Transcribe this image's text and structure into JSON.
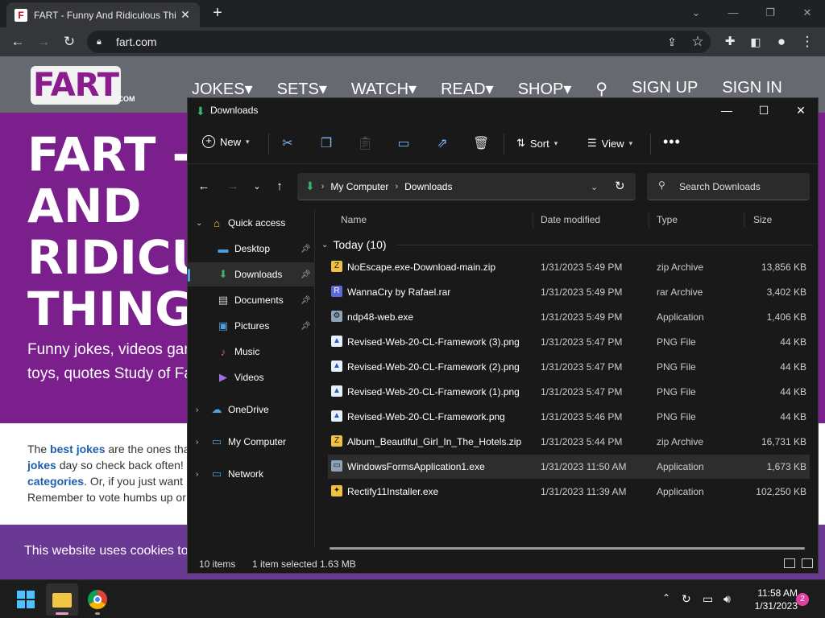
{
  "chrome": {
    "tab_title": "FART - Funny And Ridiculous Thi",
    "tab_favicon": "F",
    "url": "fart.com"
  },
  "site": {
    "logo": "FART",
    "logo_suffix": ".COM",
    "nav": [
      "JOKES",
      "SETS",
      "WATCH",
      "READ",
      "SHOP",
      "SIGN UP",
      "SIGN IN"
    ],
    "hero_title": "FART - AND RIDICU THINGS",
    "hero_sub": "Funny jokes, videos games, toys, quotes Study of Farts).",
    "body_text_1": "The ",
    "body_link_1": "best jokes",
    "body_text_2": " are the ones tha",
    "body_link_2": "jokes",
    "body_text_3": " day so check back often!",
    "body_link_3": "categories",
    "body_text_4": ".  Or, if you just want",
    "body_text_5": "Remember to vote humbs up or",
    "cookie_text": "This website uses cookies to"
  },
  "explorer": {
    "title": "Downloads",
    "cmd": {
      "new": "New",
      "sort": "Sort",
      "view": "View"
    },
    "breadcrumb": [
      "My Computer",
      "Downloads"
    ],
    "search_placeholder": "Search Downloads",
    "nav_pane": [
      {
        "label": "Quick access",
        "icon": "star-home-icon"
      },
      {
        "label": "Desktop",
        "icon": "desktop-icon",
        "pinned": true
      },
      {
        "label": "Downloads",
        "icon": "download-icon",
        "pinned": true
      },
      {
        "label": "Documents",
        "icon": "document-icon",
        "pinned": true
      },
      {
        "label": "Pictures",
        "icon": "picture-icon",
        "pinned": true
      },
      {
        "label": "Music",
        "icon": "music-icon"
      },
      {
        "label": "Videos",
        "icon": "video-icon"
      },
      {
        "label": "OneDrive",
        "icon": "cloud-icon"
      },
      {
        "label": "My Computer",
        "icon": "computer-icon"
      },
      {
        "label": "Network",
        "icon": "network-icon"
      }
    ],
    "columns": {
      "name": "Name",
      "date": "Date modified",
      "type": "Type",
      "size": "Size"
    },
    "group": "Today (10)",
    "files": [
      {
        "name": "NoEscape.exe-Download-main.zip",
        "date": "1/31/2023 5:49 PM",
        "type": "zip Archive",
        "size": "13,856 KB",
        "kind": "zip"
      },
      {
        "name": "WannaCry by Rafael.rar",
        "date": "1/31/2023 5:49 PM",
        "type": "rar Archive",
        "size": "3,402 KB",
        "kind": "rar"
      },
      {
        "name": "ndp48-web.exe",
        "date": "1/31/2023 5:49 PM",
        "type": "Application",
        "size": "1,406 KB",
        "kind": "exe"
      },
      {
        "name": "Revised-Web-20-CL-Framework (3).png",
        "date": "1/31/2023 5:47 PM",
        "type": "PNG File",
        "size": "44 KB",
        "kind": "png"
      },
      {
        "name": "Revised-Web-20-CL-Framework (2).png",
        "date": "1/31/2023 5:47 PM",
        "type": "PNG File",
        "size": "44 KB",
        "kind": "png"
      },
      {
        "name": "Revised-Web-20-CL-Framework (1).png",
        "date": "1/31/2023 5:47 PM",
        "type": "PNG File",
        "size": "44 KB",
        "kind": "png"
      },
      {
        "name": "Revised-Web-20-CL-Framework.png",
        "date": "1/31/2023 5:46 PM",
        "type": "PNG File",
        "size": "44 KB",
        "kind": "png"
      },
      {
        "name": "Album_Beautiful_Girl_In_The_Hotels.zip",
        "date": "1/31/2023 5:44 PM",
        "type": "zip Archive",
        "size": "16,731 KB",
        "kind": "zip"
      },
      {
        "name": "WindowsFormsApplication1.exe",
        "date": "1/31/2023 11:50 AM",
        "type": "Application",
        "size": "1,673 KB",
        "kind": "exe",
        "selected": true
      },
      {
        "name": "Rectify11Installer.exe",
        "date": "1/31/2023 11:39 AM",
        "type": "Application",
        "size": "102,250 KB",
        "kind": "exe"
      }
    ],
    "status_items": "10 items",
    "status_selected": "1 item selected  1.63 MB"
  },
  "taskbar": {
    "time": "11:58 AM",
    "date": "1/31/2023",
    "notifications": "2"
  }
}
